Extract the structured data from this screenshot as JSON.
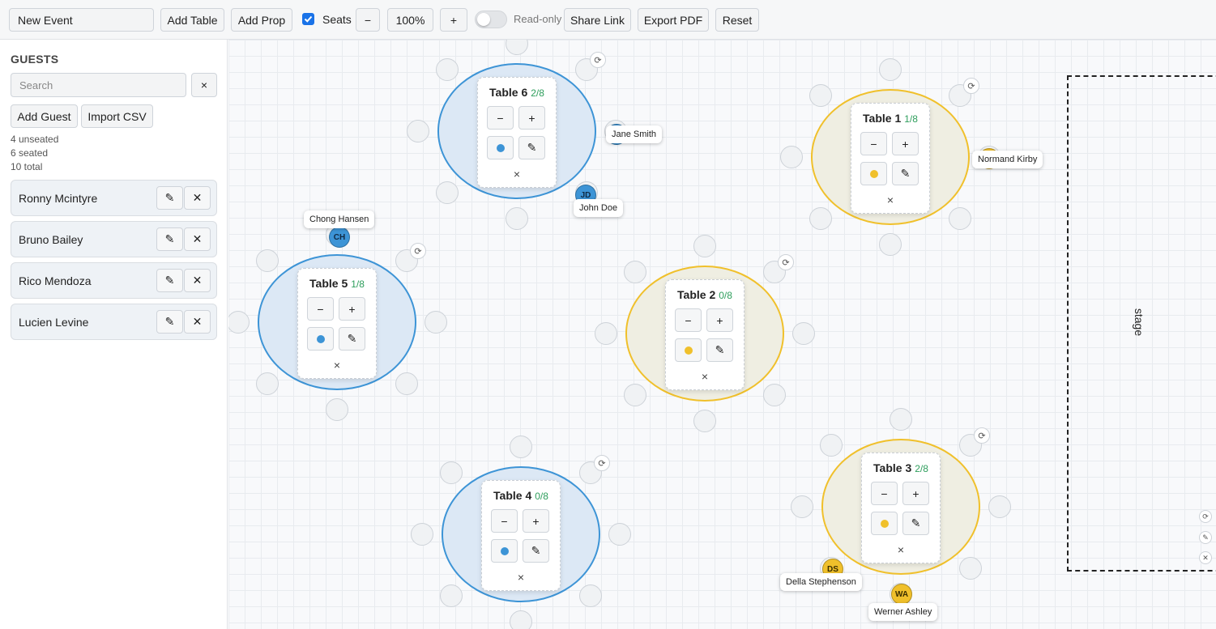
{
  "toolbar": {
    "event_name": "New Event",
    "add_table": "Add Table",
    "add_prop": "Add Prop",
    "seats_label": "Seats",
    "zoom_out": "−",
    "zoom_level": "100%",
    "zoom_in": "+",
    "readonly_label": "Read-only",
    "share_link": "Share Link",
    "export_pdf": "Export PDF",
    "reset": "Reset",
    "seats_checked": true,
    "readonly_on": false
  },
  "sidebar": {
    "heading": "GUESTS",
    "search_placeholder": "Search",
    "clear_icon": "×",
    "add_guest": "Add Guest",
    "import_csv": "Import CSV",
    "stats": {
      "unseated": "4 unseated",
      "seated": "6 seated",
      "total": "10 total"
    },
    "guests": [
      {
        "name": "Ronny Mcintyre"
      },
      {
        "name": "Bruno Bailey"
      },
      {
        "name": "Rico Mendoza"
      },
      {
        "name": "Lucien Levine"
      }
    ]
  },
  "tables": [
    {
      "name": "Table 6",
      "count": "2/8",
      "color": "blue"
    },
    {
      "name": "Table 1",
      "count": "1/8",
      "color": "yellow"
    },
    {
      "name": "Table 5",
      "count": "1/8",
      "color": "blue"
    },
    {
      "name": "Table 2",
      "count": "0/8",
      "color": "yellow"
    },
    {
      "name": "Table 4",
      "count": "0/8",
      "color": "blue"
    },
    {
      "name": "Table 3",
      "count": "2/8",
      "color": "yellow"
    }
  ],
  "panel_buttons": {
    "minus": "−",
    "plus": "+",
    "close": "×"
  },
  "seated_guests": [
    {
      "name": "Jane Smith",
      "initials": ""
    },
    {
      "name": "John Doe",
      "initials": "JD"
    },
    {
      "name": "Normand Kirby",
      "initials": ""
    },
    {
      "name": "Chong Hansen",
      "initials": "CH"
    },
    {
      "name": "Della Stephenson",
      "initials": "DS"
    },
    {
      "name": "Werner Ashley",
      "initials": "WA"
    }
  ],
  "stage": {
    "label": "stage"
  },
  "colors": {
    "blue": "#3d94d6",
    "yellow": "#f0c02b",
    "accent": "#1a73e8"
  }
}
